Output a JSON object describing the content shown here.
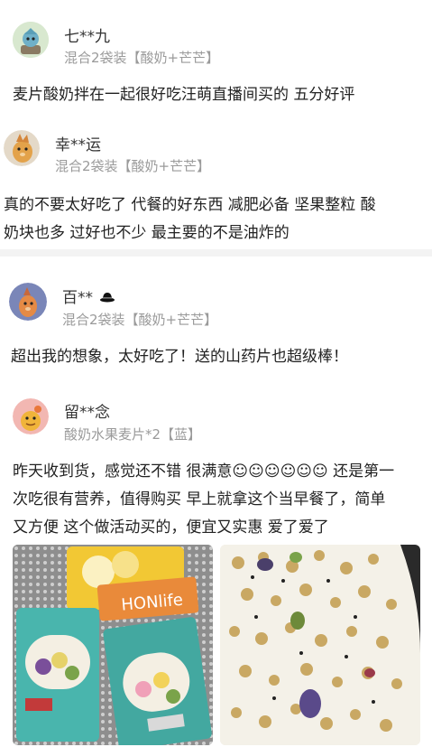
{
  "reviews": [
    {
      "username": "七**九",
      "variant": "混合2袋装【酸奶+芒芒】",
      "text": "麦片酸奶拌在一起很好吃汪萌直播间买的 五分好评"
    },
    {
      "username": "幸**运",
      "variant": "混合2袋装【酸奶+芒芒】",
      "text_lines": [
        "真的不要太好吃了 代餐的好东西 减肥必备 坚果整粒 酸",
        "奶块也多 过好也不少 最主要的不是油炸的"
      ]
    },
    {
      "username": "百**",
      "variant": "混合2袋装【酸奶+芒芒】",
      "text": "超出我的想象，太好吃了！送的山药片也超级棒！"
    },
    {
      "username": "留**念",
      "variant": "酸奶水果麦片*2【蓝】",
      "text_lines": [
        "昨天收到货，感觉还不错 很满意☺☺☺☺☺☺ 还是第一",
        "次吃很有营养，值得购买 早上就拿这个当早餐了，简单",
        "又方便 这个做活动买的，便宜又实惠 爱了爱了"
      ],
      "photo_brand": "HONlife"
    }
  ]
}
